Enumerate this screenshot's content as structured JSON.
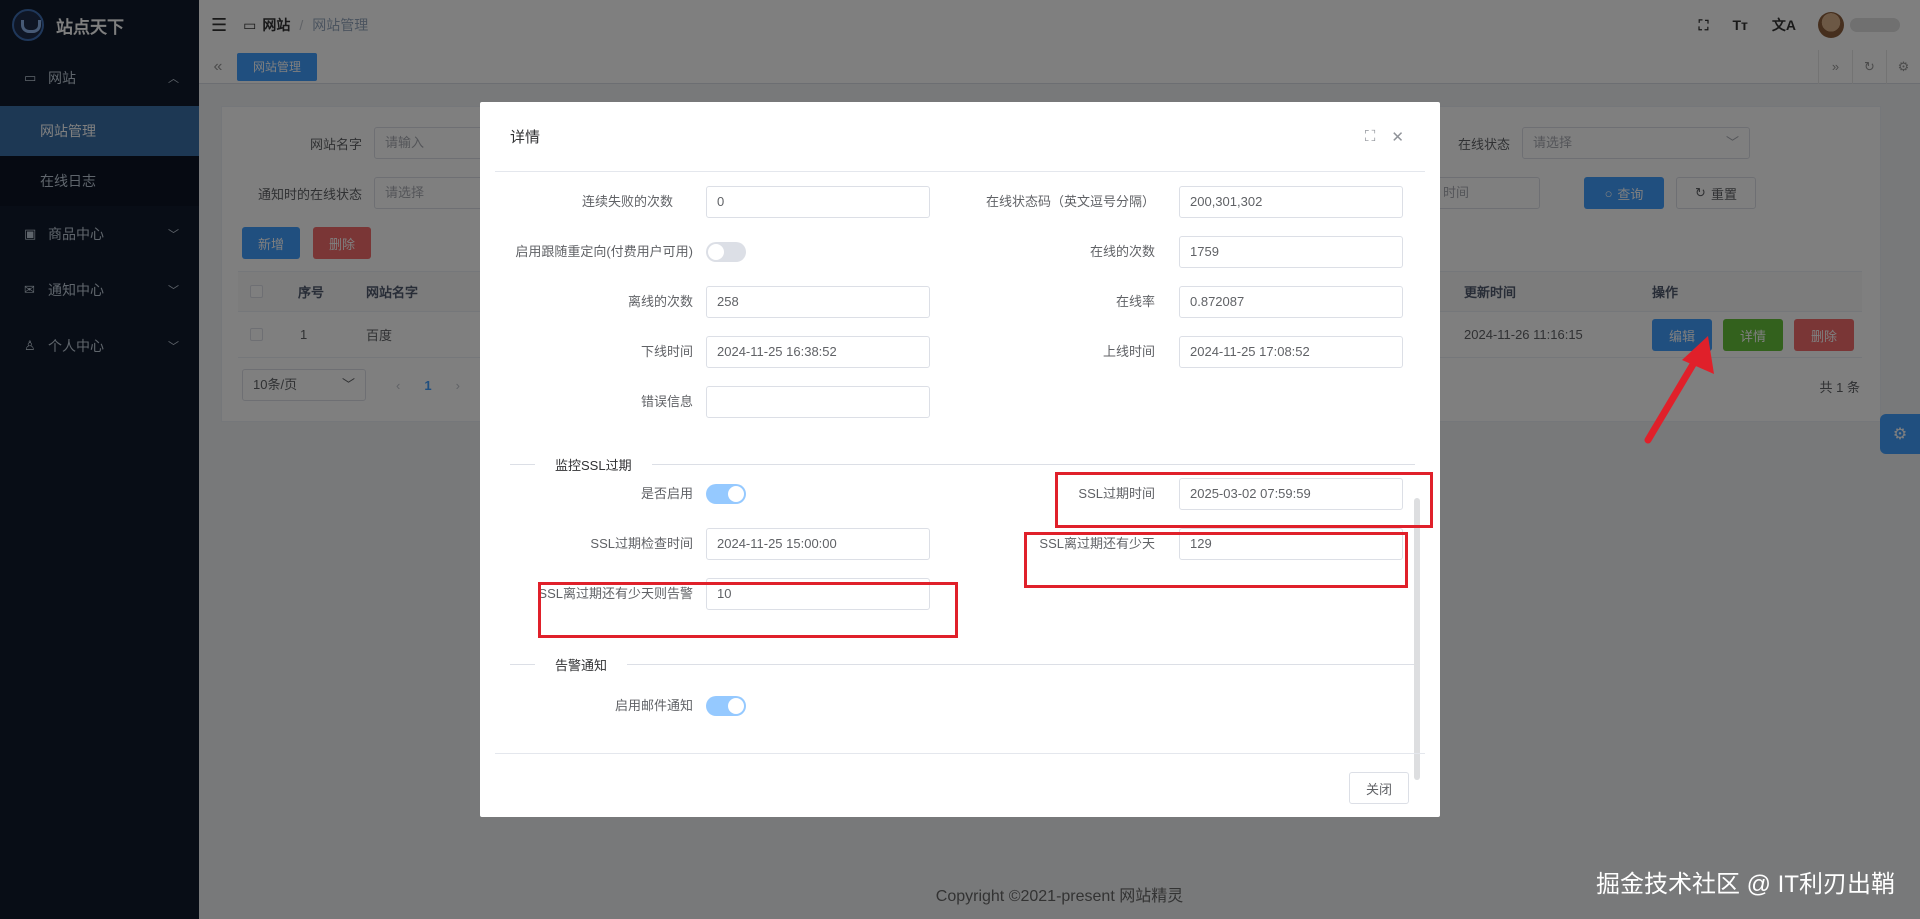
{
  "app": {
    "name": "站点天下"
  },
  "sidebar": {
    "groups": [
      {
        "label": "网站",
        "icon": "monitor-icon",
        "open": true,
        "items": [
          {
            "label": "网站管理",
            "active": true
          },
          {
            "label": "在线日志",
            "active": false
          }
        ]
      },
      {
        "label": "商品中心",
        "icon": "bag-icon"
      },
      {
        "label": "通知中心",
        "icon": "mail-icon"
      },
      {
        "label": "个人中心",
        "icon": "user-icon"
      }
    ]
  },
  "header": {
    "breadcrumb": [
      "网站",
      "网站管理"
    ],
    "icons": [
      "fullscreen-icon",
      "font-size-icon",
      "translate-icon"
    ]
  },
  "tags": {
    "active": "网站管理"
  },
  "filters": {
    "site_name": {
      "label": "网站名字",
      "placeholder": "请输入"
    },
    "notify_status": {
      "label": "通知时的在线状态",
      "placeholder": "请选择"
    },
    "online_status": {
      "label": "在线状态",
      "placeholder": "请选择"
    },
    "time_placeholder": "时间",
    "search_label": "查询",
    "reset_label": "重置"
  },
  "toolbar": {
    "add_label": "新增",
    "delete_label": "删除"
  },
  "table": {
    "columns": {
      "index": "序号",
      "name": "网站名字",
      "updated": "更新时间",
      "actions": "操作"
    },
    "rows": [
      {
        "index": "1",
        "name": "百度",
        "updated": "2024-11-26 11:16:15"
      }
    ],
    "row_actions": {
      "edit": "编辑",
      "detail": "详情",
      "delete": "删除"
    }
  },
  "pagination": {
    "page_size": "10条/页",
    "current": "1",
    "total": "共 1 条"
  },
  "footer": {
    "copyright": "Copyright ©2021-present 网站精灵"
  },
  "dialog": {
    "title": "详情",
    "fields": {
      "fail_count_label": "连续失败的次数",
      "fail_count": "0",
      "status_codes_label": "在线状态码（英文逗号分隔）",
      "status_codes": "200,301,302",
      "follow_redirect_label": "启用跟随重定向(付费用户可用)",
      "online_count_label": "在线的次数",
      "online_count": "1759",
      "offline_count_label": "离线的次数",
      "offline_count": "258",
      "online_rate_label": "在线率",
      "online_rate": "0.872087",
      "offline_time_label": "下线时间",
      "offline_time": "2024-11-25 16:38:52",
      "online_time_label": "上线时间",
      "online_time": "2024-11-25 17:08:52",
      "error_label": "错误信息",
      "error": ""
    },
    "ssl_section": "监控SSL过期",
    "ssl": {
      "enabled_label": "是否启用",
      "expire_time_label": "SSL过期时间",
      "expire_time": "2025-03-02 07:59:59",
      "check_time_label": "SSL过期检查时间",
      "check_time": "2024-11-25 15:00:00",
      "days_left_label": "SSL离过期还有少天",
      "days_left": "129",
      "alert_days_label": "SSL离过期还有少天则告警",
      "alert_days": "10"
    },
    "alert_section": "告警通知",
    "alert": {
      "email_label": "启用邮件通知"
    },
    "close_label": "关闭"
  },
  "watermark": "掘金技术社区 @ IT利刃出鞘",
  "colors": {
    "primary": "#409eff",
    "danger": "#f56c6c",
    "success": "#67c23a",
    "sidebar": "#111b2c",
    "highlight": "#e0202a"
  }
}
